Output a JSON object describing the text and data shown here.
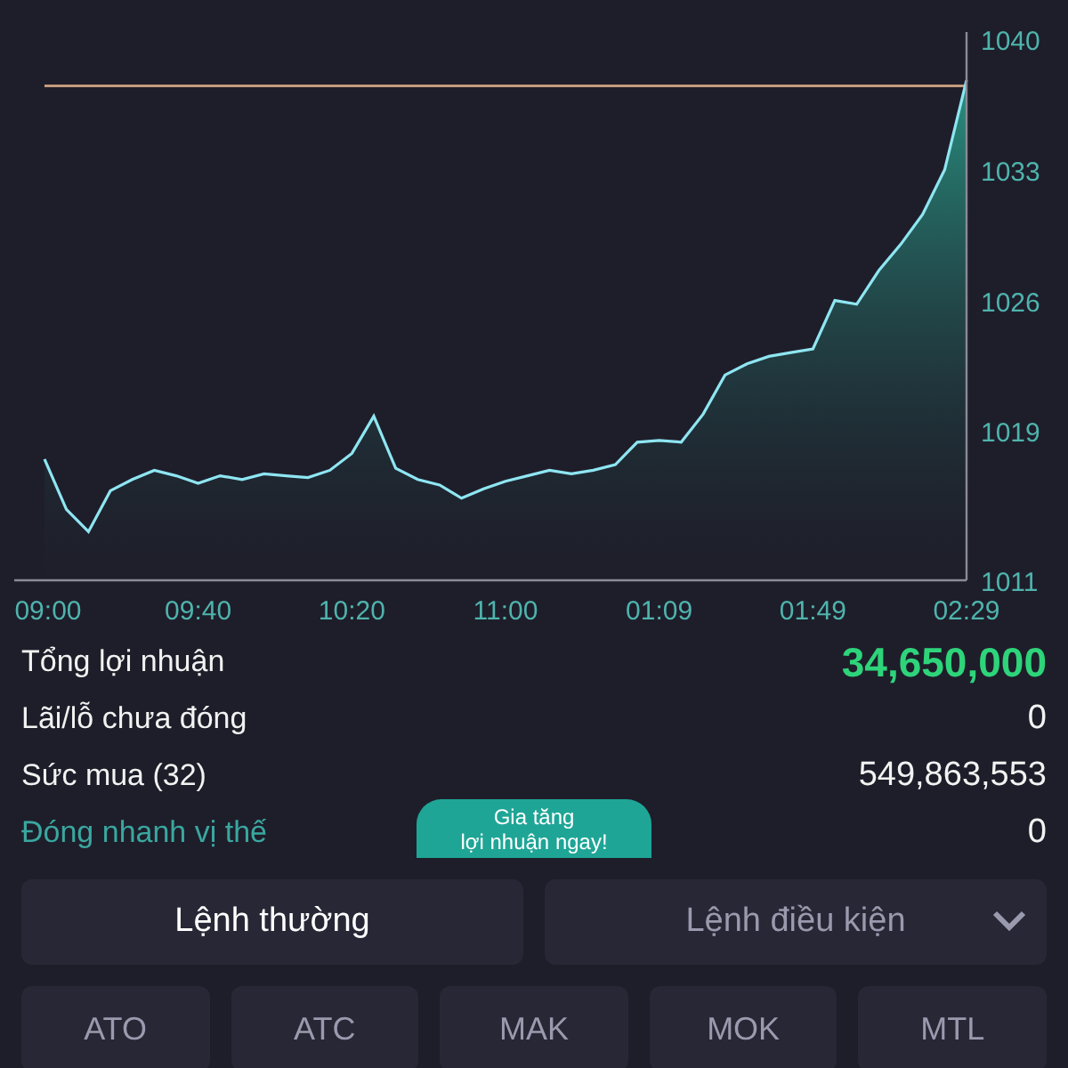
{
  "chart": {
    "chart_data": {
      "type": "area",
      "categories": [
        "09:00",
        null,
        null,
        null,
        null,
        null,
        null,
        "09:40",
        null,
        null,
        null,
        null,
        null,
        null,
        "10:20",
        null,
        null,
        null,
        null,
        null,
        null,
        "11:00",
        null,
        null,
        null,
        null,
        null,
        null,
        "01:09",
        null,
        null,
        null,
        null,
        null,
        null,
        "01:49",
        null,
        null,
        null,
        null,
        null,
        null,
        "02:29"
      ],
      "series": [
        {
          "type": "area",
          "color": "#8ee6f2",
          "values": [
            1017.5,
            1014.8,
            1013.6,
            1015.8,
            1016.4,
            1016.9,
            1016.6,
            1016.2,
            1016.6,
            1016.4,
            1016.7,
            1016.6,
            1016.5,
            1016.9,
            1017.8,
            1019.8,
            1017.0,
            1016.4,
            1016.1,
            1015.4,
            1015.9,
            1016.3,
            1016.6,
            1016.9,
            1016.7,
            1016.9,
            1017.2,
            1018.4,
            1018.5,
            1018.4,
            1019.9,
            1022.0,
            1022.6,
            1023.0,
            1023.2,
            1023.4,
            1026.0,
            1025.8,
            1027.6,
            1029.0,
            1030.6,
            1033.0,
            1037.8
          ]
        },
        {
          "type": "line",
          "color": "#c49a7c",
          "values": [
            1037.5,
            1037.5,
            1037.5,
            1037.5,
            1037.5,
            1037.5,
            1037.5,
            1037.5,
            1037.5,
            1037.5,
            1037.5,
            1037.5,
            1037.5,
            1037.5,
            1037.5,
            1037.5,
            1037.5,
            1037.5,
            1037.5,
            1037.5,
            1037.5,
            1037.5,
            1037.5,
            1037.5,
            1037.5,
            1037.5,
            1037.5,
            1037.5,
            1037.5,
            1037.5,
            1037.5,
            1037.5,
            1037.5,
            1037.5,
            1037.5,
            1037.5,
            1037.5,
            1037.5,
            1037.5,
            1037.5,
            1037.5,
            1037.5,
            1037.5
          ]
        }
      ],
      "ylim": [
        1011,
        1040
      ],
      "yticks": [
        1011,
        1019,
        1026,
        1033,
        1040
      ]
    }
  },
  "stats": [
    {
      "label": "Tổng lợi nhuận",
      "value": "34,650,000",
      "kind": "highlight"
    },
    {
      "label": "Lãi/lỗ chưa đóng",
      "value": "0",
      "kind": "plain"
    },
    {
      "label": "Sức mua (32)",
      "value": "549,863,553",
      "kind": "plain"
    },
    {
      "label": "Đóng nhanh vị thế",
      "value": "0",
      "kind": "link"
    }
  ],
  "promo": {
    "line_1": "Gia tăng",
    "line_2": "lợi nhuận ngay!"
  },
  "order_tabs": [
    {
      "label": "Lệnh thường",
      "selected": true,
      "kind": "plain"
    },
    {
      "label": "Lệnh điều kiện",
      "selected": false,
      "kind": "dropdown"
    }
  ],
  "order_types": [
    "ATO",
    "ATC",
    "MAK",
    "MOK",
    "MTL"
  ]
}
